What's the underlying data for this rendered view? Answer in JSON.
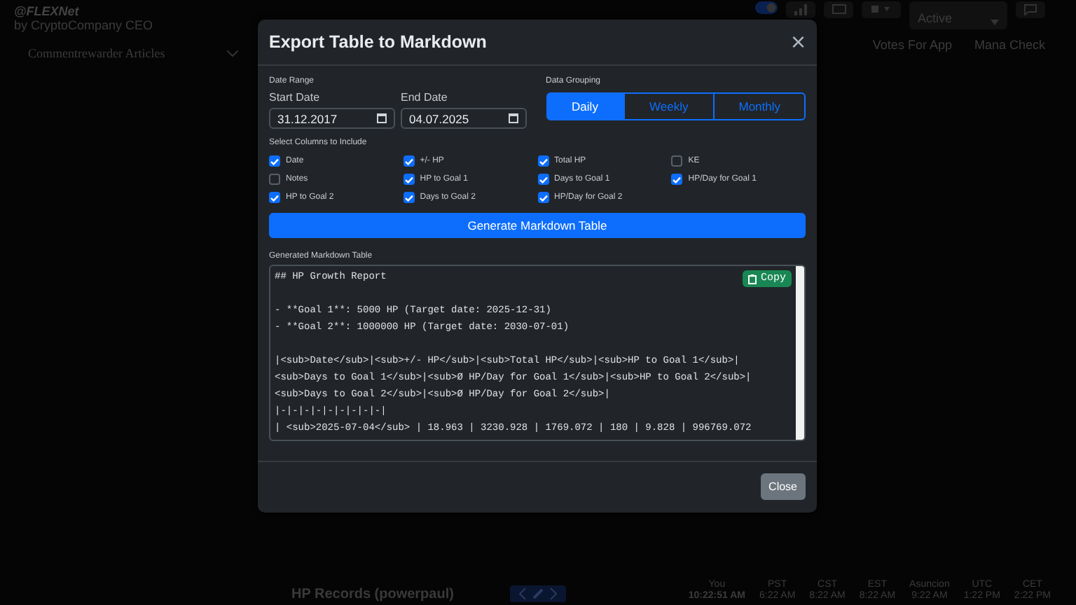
{
  "background": {
    "profile": {
      "handle": "@FLEXNet",
      "subtitle": "by CryptoCompany CEO"
    },
    "articles_select": {
      "value": "Commentrewarder Articles"
    },
    "status_select": {
      "value": "Active"
    },
    "links": [
      "Votes For App",
      "Mana Check"
    ],
    "records_title": "HP Records (powerpaul)",
    "clocks": [
      {
        "zone": "You",
        "time": "10:22:51 AM"
      },
      {
        "zone": "PST",
        "time": "6:22 AM"
      },
      {
        "zone": "CST",
        "time": "8:22 AM"
      },
      {
        "zone": "EST",
        "time": "8:22 AM"
      },
      {
        "zone": "Asuncion",
        "time": "9:22 AM"
      },
      {
        "zone": "UTC",
        "time": "1:22 PM"
      },
      {
        "zone": "CET",
        "time": "2:22 PM"
      }
    ]
  },
  "modal": {
    "title": "Export Table to Markdown",
    "close": "×",
    "date_range": {
      "label": "Date Range",
      "start": {
        "label": "Start Date",
        "value": "31.12.2017"
      },
      "end": {
        "label": "End Date",
        "value": "04.07.2025"
      }
    },
    "grouping": {
      "label": "Data Grouping",
      "options": [
        {
          "label": "Daily",
          "selected": true
        },
        {
          "label": "Weekly",
          "selected": false
        },
        {
          "label": "Monthly",
          "selected": false
        }
      ]
    },
    "columns_label": "Select Columns to Include",
    "columns": [
      {
        "label": "Date",
        "checked": true
      },
      {
        "label": "+/- HP",
        "checked": true
      },
      {
        "label": "Total HP",
        "checked": true
      },
      {
        "label": "KE",
        "checked": false
      },
      {
        "label": "Notes",
        "checked": false
      },
      {
        "label": "HP to Goal 1",
        "checked": true
      },
      {
        "label": "Days to Goal 1",
        "checked": true
      },
      {
        "label": "HP/Day for Goal 1",
        "checked": true
      },
      {
        "label": "HP to Goal 2",
        "checked": true
      },
      {
        "label": "Days to Goal 2",
        "checked": true
      },
      {
        "label": "HP/Day for Goal 2",
        "checked": true
      }
    ],
    "generate_button": "Generate Markdown Table",
    "output_label": "Generated Markdown Table",
    "copy_button": "Copy",
    "output_blocks": [
      [
        "## HP Growth Report"
      ],
      [
        "- **Goal 1**: 5000 HP (Target date: 2025-12-31)",
        "- **Goal 2**: 1000000 HP (Target date: 2030-07-01)"
      ],
      [
        "|<sub>Date</sub>|<sub>+/- HP</sub>|<sub>Total HP</sub>|<sub>HP to Goal 1</sub>|",
        "<sub>Days to Goal 1</sub>|<sub>Ø HP/Day for Goal 1</sub>|<sub>HP to Goal 2</sub>|",
        "<sub>Days to Goal 2</sub>|<sub>Ø HP/Day for Goal 2</sub>|",
        "|-|-|-|-|-|-|-|-|-|",
        "| <sub>2025-07-04</sub> | 18.963 | 3230.928 | 1769.072 | 180 | 9.828 | 996769.072"
      ]
    ],
    "close_button": "Close"
  }
}
